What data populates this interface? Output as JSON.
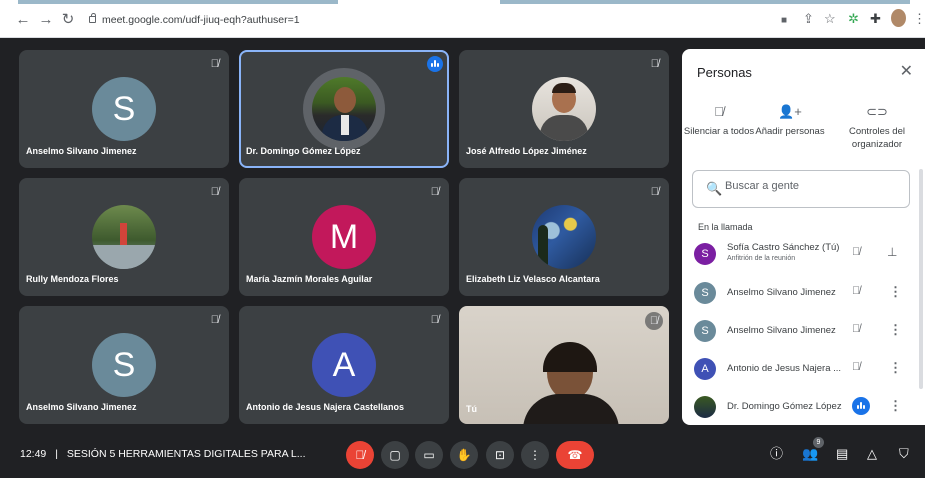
{
  "browser": {
    "url": "meet.google.com/udf-jiuq-eqh?authuser=1",
    "icons": [
      "back-icon",
      "forward-icon",
      "reload-icon",
      "lock-icon",
      "cast-icon",
      "share-icon",
      "star-icon",
      "extension-icon",
      "puzzle-icon",
      "profile-avatar",
      "menu-icon"
    ]
  },
  "tiles": [
    {
      "name": "Anselmo Silvano Jimenez",
      "letter": "S",
      "color": "#6a8a9a",
      "muted": true
    },
    {
      "name": "Dr. Domingo Gómez López",
      "photo": true,
      "speaking": true
    },
    {
      "name": "José Alfredo López Jiménez",
      "photo": true,
      "muted": true
    },
    {
      "name": "Rully Mendoza Flores",
      "photo": true,
      "muted": true
    },
    {
      "name": "María Jazmín Morales Aguilar",
      "letter": "M",
      "color": "#c2185b",
      "muted": true
    },
    {
      "name": "Elizabeth Liz Velasco Alcantara",
      "photo": true,
      "muted": true
    },
    {
      "name": "Anselmo Silvano Jimenez",
      "letter": "S",
      "color": "#6a8a9a",
      "muted": true
    },
    {
      "name": "Antonio de Jesus Najera Castellanos",
      "letter": "A",
      "color": "#3f51b5",
      "muted": true
    },
    {
      "name": "Tú",
      "self_video": true,
      "muted": true
    }
  ],
  "bottombar": {
    "time": "12:49",
    "separator": "|",
    "meeting_title": "SESIÓN 5 HERRAMIENTAS DIGITALES PARA L...",
    "people_count": "9",
    "colors": {
      "hangup": "#ea4335",
      "control_bg": "#3c4043"
    }
  },
  "panel": {
    "title": "Personas",
    "actions": [
      {
        "label": "Silenciar a todos",
        "icon": "mic-off-icon"
      },
      {
        "label": "Añadir personas",
        "icon": "add-person-icon"
      },
      {
        "label": "Controles del organizador",
        "icon": "toggle-icon"
      }
    ],
    "search_placeholder": "Buscar a gente",
    "section_label": "En la llamada",
    "participants": [
      {
        "name": "Sofía Castro Sánchez (Tú)",
        "subtitle": "Anfitrión de la reunión",
        "letter": "S",
        "color": "#7b1fa2"
      },
      {
        "name": "Anselmo Silvano Jimenez",
        "letter": "S",
        "color": "#6a8a9a"
      },
      {
        "name": "Anselmo Silvano Jimenez",
        "letter": "S",
        "color": "#6a8a9a"
      },
      {
        "name": "Antonio de Jesus Najera ...",
        "letter": "A",
        "color": "#3f51b5"
      },
      {
        "name": "Dr. Domingo Gómez López",
        "photo": true
      }
    ]
  }
}
